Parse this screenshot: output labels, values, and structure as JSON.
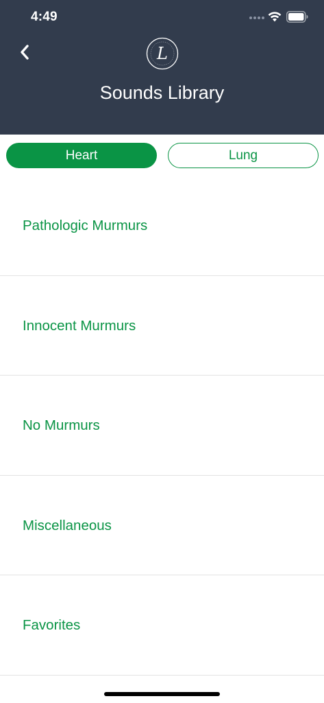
{
  "status_bar": {
    "time": "4:49"
  },
  "header": {
    "title": "Sounds Library",
    "logo_letter": "L",
    "background_color": "#323c4d"
  },
  "tabs": [
    {
      "label": "Heart",
      "selected": true
    },
    {
      "label": "Lung",
      "selected": false
    }
  ],
  "categories": [
    {
      "label": "Pathologic Murmurs"
    },
    {
      "label": "Innocent Murmurs"
    },
    {
      "label": "No Murmurs"
    },
    {
      "label": "Miscellaneous"
    },
    {
      "label": "Favorites"
    }
  ],
  "colors": {
    "accent": "#0a9445",
    "header": "#323c4d",
    "divider": "#e3e3e3"
  },
  "icons": {
    "back": "chevron-left-icon",
    "wifi": "wifi-icon",
    "battery": "battery-icon",
    "logo": "littmann-logo"
  }
}
